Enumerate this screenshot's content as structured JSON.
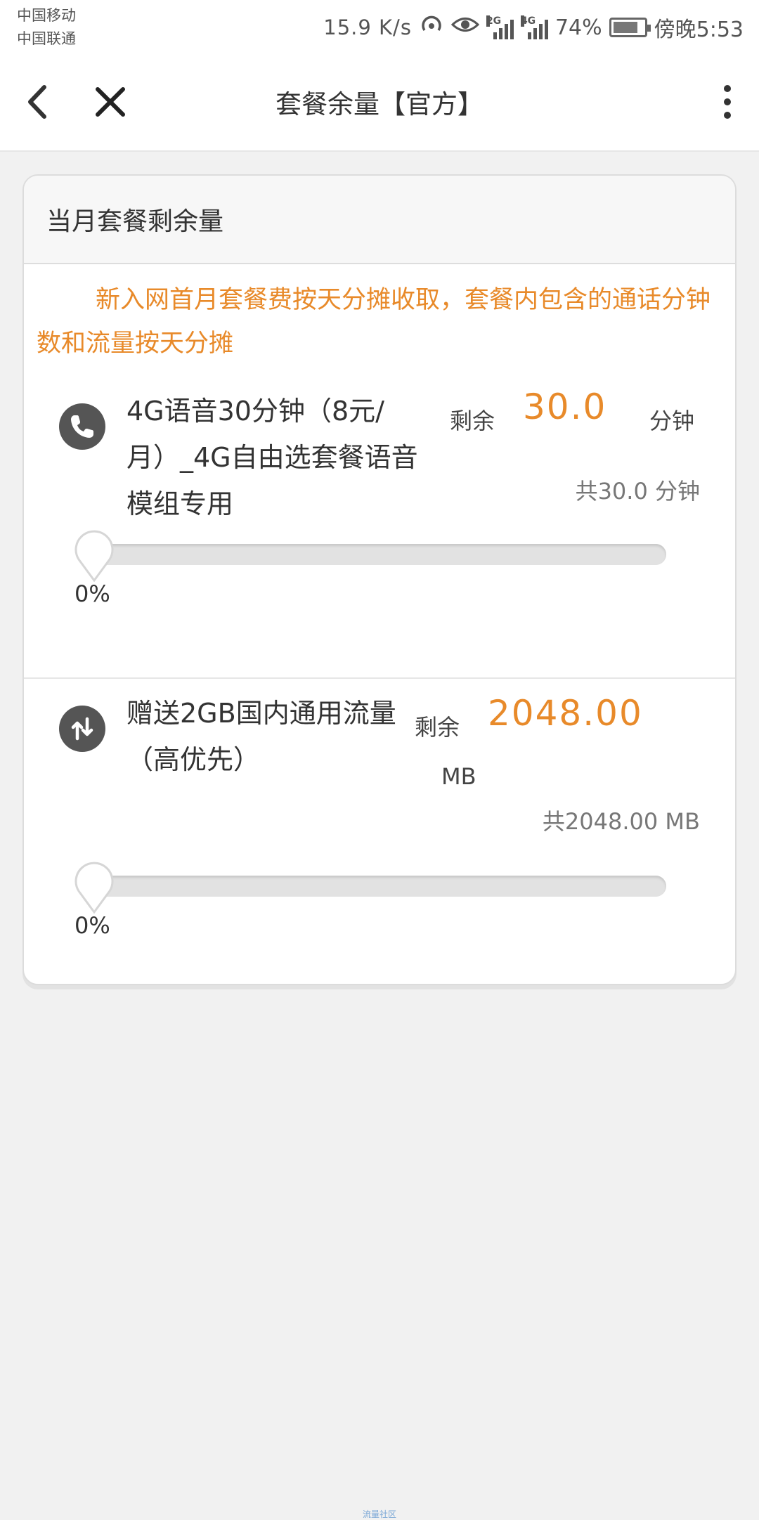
{
  "status_bar": {
    "carrier_1": "中国移动",
    "carrier_2": "中国联通",
    "speed": "15.9 K/s",
    "net_1": "2G",
    "net_2": "4G",
    "battery": "74%",
    "time": "傍晚5:53"
  },
  "title_bar": {
    "title": "套餐余量【官方】"
  },
  "card": {
    "header": "当月套餐剩余量",
    "notice": "新入网首月套餐费按天分摊收取，套餐内包含的通话分钟数和流量按天分摊",
    "items": [
      {
        "icon": "phone-icon",
        "name": "4G语音30分钟（8元/月）_4G自由选套餐语音模组专用",
        "remain_label": "剩余",
        "remain_value": "30.0",
        "unit": "分钟",
        "total": "共30.0 分钟",
        "percent_text": "0%",
        "percent": 0
      },
      {
        "icon": "data-transfer-icon",
        "name": "赠送2GB国内通用流量（高优先）",
        "remain_label": "剩余",
        "remain_value": "2048.00",
        "unit": "MB",
        "total": "共2048.00 MB",
        "percent_text": "0%",
        "percent": 0
      }
    ]
  },
  "footer": {
    "watermark": "流量社区"
  },
  "colors": {
    "accent": "#e88a2a",
    "background": "#f1f1f1",
    "icon_bg": "#555555"
  }
}
